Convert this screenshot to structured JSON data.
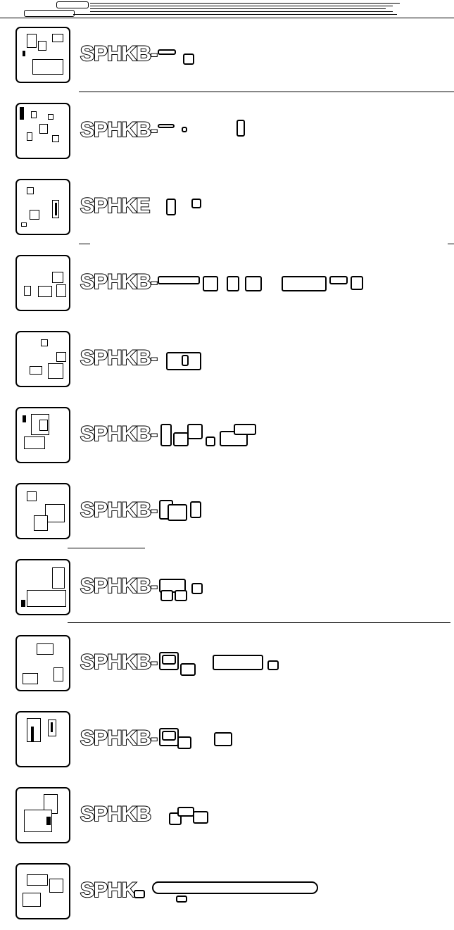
{
  "header": {
    "title": ""
  },
  "list": {
    "items": [
      {
        "label": "SPHKB-",
        "icon": "pcb-module-icon"
      },
      {
        "label": "SPHKB-",
        "icon": "pcb-module-icon"
      },
      {
        "label": "SPHKE",
        "icon": "pcb-module-icon"
      },
      {
        "label": "SPHKB-",
        "icon": "pcb-module-icon"
      },
      {
        "label": "SPHKB-",
        "icon": "pcb-module-icon"
      },
      {
        "label": "SPHKB-",
        "icon": "pcb-module-icon"
      },
      {
        "label": "SPHKB-",
        "icon": "pcb-module-icon"
      },
      {
        "label": "SPHKB-",
        "icon": "pcb-module-icon"
      },
      {
        "label": "SPHKB-",
        "icon": "pcb-module-icon"
      },
      {
        "label": "SPHKB-",
        "icon": "pcb-module-icon"
      },
      {
        "label": "SPHKB",
        "icon": "pcb-module-icon"
      },
      {
        "label": "SPHK",
        "icon": "pcb-module-icon"
      }
    ]
  },
  "colors": {
    "foreground": "#000000",
    "background": "#ffffff"
  }
}
